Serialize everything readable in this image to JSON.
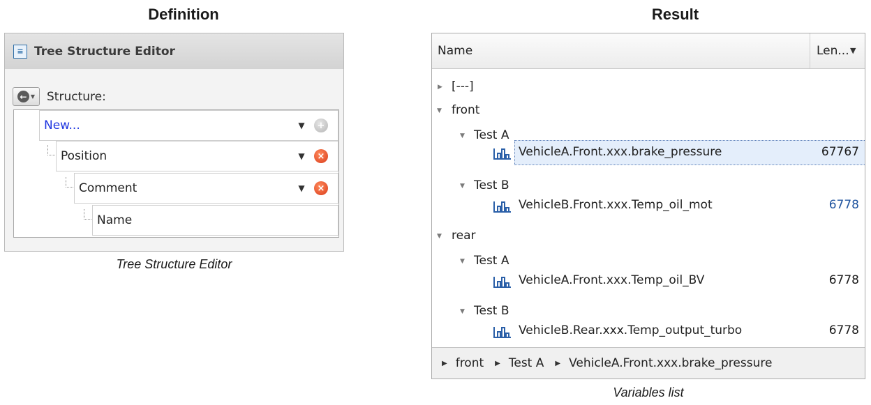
{
  "headings": {
    "definition": "Definition",
    "result": "Result"
  },
  "editor": {
    "title": "Tree Structure Editor",
    "structure_label": "Structure:",
    "rows": [
      {
        "label": "New...",
        "action": "add"
      },
      {
        "label": "Position",
        "action": "remove"
      },
      {
        "label": "Comment",
        "action": "remove"
      },
      {
        "label": "Name",
        "action": "none"
      }
    ],
    "caption": "Tree Structure Editor"
  },
  "variables": {
    "col_name": "Name",
    "col_len": "Len...",
    "root_collapsed": "[---]",
    "front": {
      "label": "front",
      "test_a": {
        "label": "Test A",
        "var": "VehicleA.Front.xxx.brake_pressure",
        "len": "67767"
      },
      "test_b": {
        "label": "Test B",
        "var": "VehicleB.Front.xxx.Temp_oil_mot",
        "len": "6778"
      }
    },
    "rear": {
      "label": "rear",
      "test_a": {
        "label": "Test A",
        "var": "VehicleA.Front.xxx.Temp_oil_BV",
        "len": "6778"
      },
      "test_b": {
        "label": "Test B",
        "var": "VehicleB.Rear.xxx.Temp_output_turbo",
        "len": "6778"
      }
    },
    "breadcrumb": [
      "front",
      "Test A",
      "VehicleA.Front.xxx.brake_pressure"
    ],
    "caption": "Variables list"
  },
  "icons": [
    "tree-editor-icon",
    "back-arrow-icon",
    "add-icon",
    "remove-icon",
    "chart-icon",
    "expand-icon",
    "collapse-icon"
  ]
}
